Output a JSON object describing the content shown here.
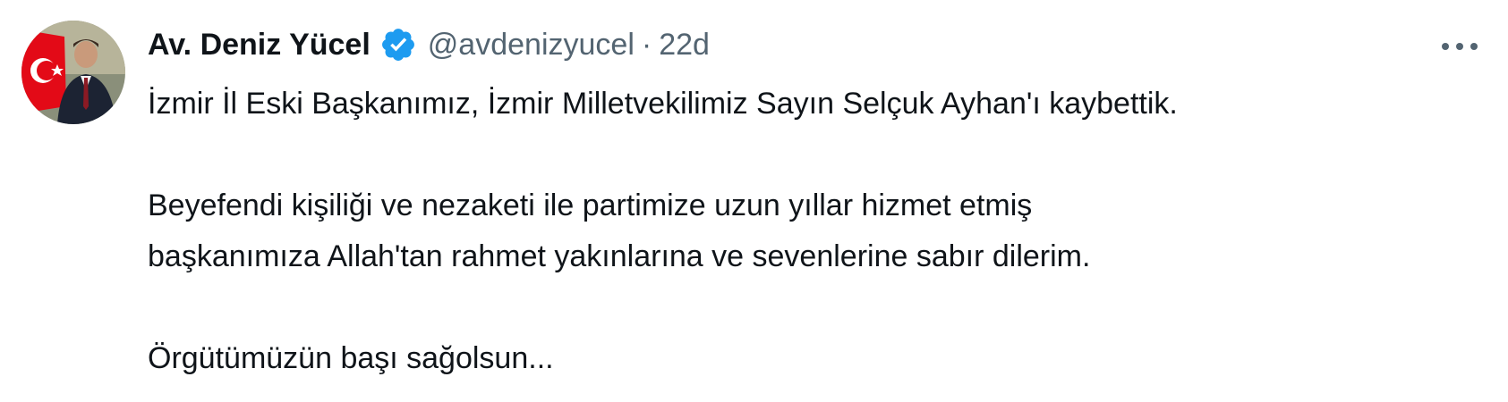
{
  "tweet": {
    "author": {
      "name": "Av. Deniz Yücel",
      "handle": "@avdenizyucel",
      "verified": true,
      "avatar_icon": "profile-avatar"
    },
    "separator": "·",
    "time": "22d",
    "more_icon": "more-horizontal-icon",
    "text": {
      "line1": "İzmir İl Eski Başkanımız, İzmir Milletvekilimiz Sayın Selçuk Ayhan'ı kaybettik.",
      "line2": "Beyefendi kişiliği ve nezaketi ile partimize uzun yıllar hizmet etmiş",
      "line3": "başkanımıza Allah'tan rahmet yakınlarına ve sevenlerine sabır dilerim.",
      "line4": "Örgütümüzün başı sağolsun..."
    },
    "colors": {
      "text": "#0f1419",
      "secondary": "#536471",
      "verified_badge": "#1d9bf0",
      "flag_red": "#e30a17"
    }
  }
}
